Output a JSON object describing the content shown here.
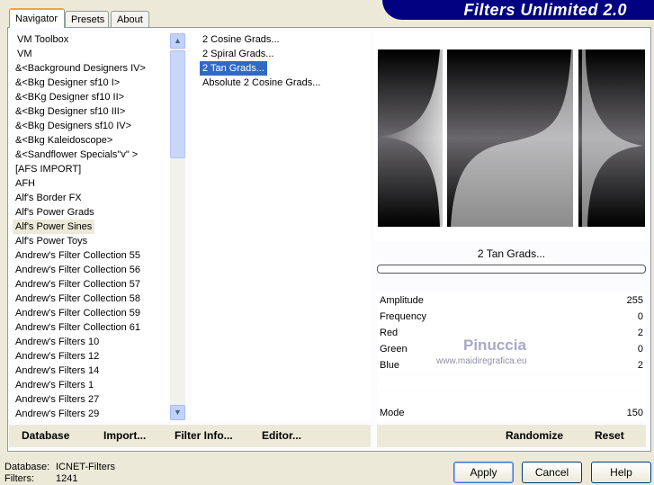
{
  "app_title": "Filters Unlimited 2.0",
  "tabs": [
    {
      "label": "Navigator",
      "active": true
    },
    {
      "label": "Presets"
    },
    {
      "label": "About"
    }
  ],
  "categories": [
    "VM Toolbox",
    "VM",
    "&<Background Designers IV>",
    "&<Bkg Designer sf10 I>",
    "&<BKg Designer sf10 II>",
    "&<Bkg Designer sf10 III>",
    "&<Bkg Designers sf10 IV>",
    "&<Bkg Kaleidoscope>",
    "&<Sandflower Specials\"v\" >",
    "[AFS IMPORT]",
    "AFH",
    "Alf's Border FX",
    "Alf's Power Grads",
    "Alf's Power Sines",
    "Alf's Power Toys",
    "Andrew's Filter Collection 55",
    "Andrew's Filter Collection 56",
    "Andrew's Filter Collection 57",
    "Andrew's Filter Collection 58",
    "Andrew's Filter Collection 59",
    "Andrew's Filter Collection 61",
    "Andrew's Filters 10",
    "Andrew's Filters 12",
    "Andrew's Filters 14",
    "Andrew's Filters 1",
    "Andrew's Filters 27",
    "Andrew's Filters 29"
  ],
  "selected_category": "Alf's Power Sines",
  "filters": [
    "2 Cosine Grads...",
    "2 Spiral Grads...",
    "2 Tan Grads...",
    "Absolute 2 Cosine Grads..."
  ],
  "selected_filter": "2 Tan Grads...",
  "preview_caption": "2 Tan Grads...",
  "progress": 0,
  "params": [
    {
      "name": "Amplitude",
      "value": "255"
    },
    {
      "name": "Frequency",
      "value": "0"
    },
    {
      "name": "Red",
      "value": "2"
    },
    {
      "name": "Green",
      "value": "0"
    },
    {
      "name": "Blue",
      "value": "2"
    },
    {
      "name": "",
      "value": ""
    },
    {
      "name": "",
      "value": ""
    },
    {
      "name": "Mode",
      "value": "150"
    }
  ],
  "watermark": {
    "name": "Pinuccia",
    "url": "www.maidiregrafica.eu"
  },
  "left_buttons": [
    "Database",
    "Import...",
    "Filter Info...",
    "Editor..."
  ],
  "right_buttons": [
    "Randomize",
    "Reset"
  ],
  "status": {
    "database_label": "Database:",
    "database_value": "ICNET-Filters",
    "filters_label": "Filters:",
    "filters_value": "1241"
  },
  "dialog_buttons": [
    "Apply",
    "Cancel",
    "Help"
  ],
  "colors": {
    "selection": "#316ac5",
    "banner": "#000080",
    "panel": "#ece9d8"
  }
}
